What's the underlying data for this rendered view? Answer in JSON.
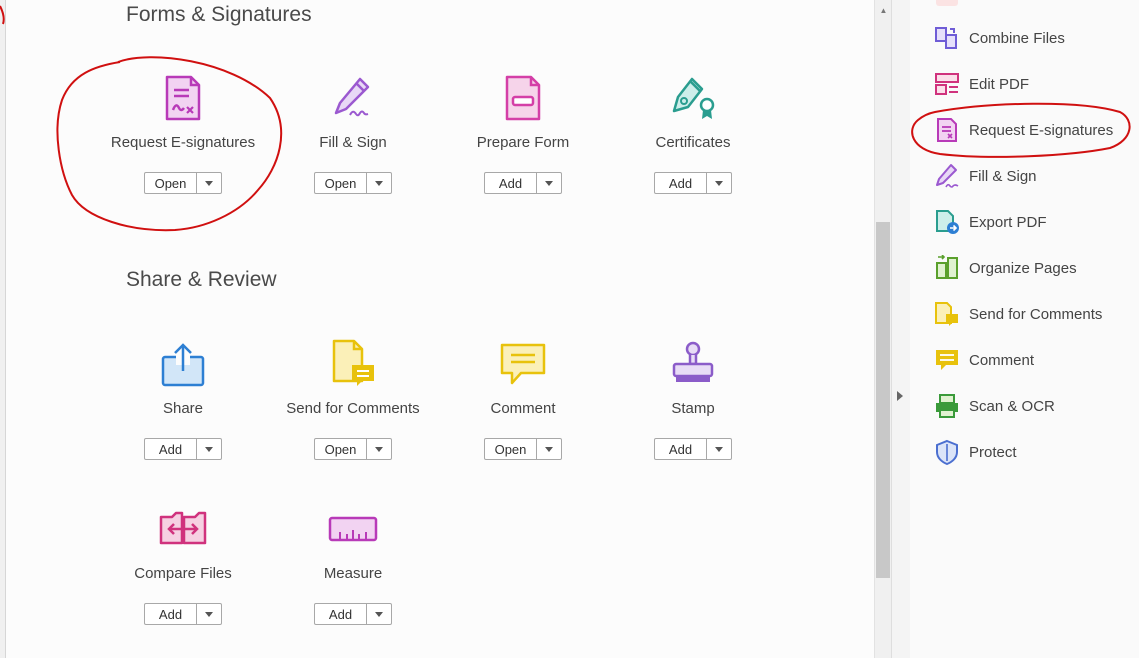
{
  "sections": [
    {
      "title": "Forms & Signatures"
    },
    {
      "title": "Share & Review"
    }
  ],
  "tools": [
    {
      "label": "Request E-signatures",
      "button": "Open",
      "icon": "request-esignatures-icon",
      "color": "#b83ab8"
    },
    {
      "label": "Fill & Sign",
      "button": "Open",
      "icon": "fill-sign-icon",
      "color": "#9b59d0"
    },
    {
      "label": "Prepare Form",
      "button": "Add",
      "icon": "prepare-form-icon",
      "color": "#d43fa7"
    },
    {
      "label": "Certificates",
      "button": "Add",
      "icon": "certificates-icon",
      "color": "#2a9d8f"
    },
    {
      "label": "Share",
      "button": "Add",
      "icon": "share-icon",
      "color": "#2d7fd3"
    },
    {
      "label": "Send for Comments",
      "button": "Open",
      "icon": "send-for-comments-icon",
      "color": "#e8c20c"
    },
    {
      "label": "Comment",
      "button": "Open",
      "icon": "comment-icon",
      "color": "#e8c20c"
    },
    {
      "label": "Stamp",
      "button": "Add",
      "icon": "stamp-icon",
      "color": "#8b5cc9"
    },
    {
      "label": "Compare Files",
      "button": "Add",
      "icon": "compare-files-icon",
      "color": "#d0327d"
    },
    {
      "label": "Measure",
      "button": "Add",
      "icon": "measure-icon",
      "color": "#b83ab8"
    }
  ],
  "right_panel": {
    "items": [
      {
        "label": "Combine Files",
        "icon": "combine-files-icon"
      },
      {
        "label": "Edit PDF",
        "icon": "edit-pdf-icon"
      },
      {
        "label": "Request E-signatures",
        "icon": "request-esignatures-icon"
      },
      {
        "label": "Fill & Sign",
        "icon": "fill-sign-icon"
      },
      {
        "label": "Export PDF",
        "icon": "export-pdf-icon"
      },
      {
        "label": "Organize Pages",
        "icon": "organize-pages-icon"
      },
      {
        "label": "Send for Comments",
        "icon": "send-for-comments-icon"
      },
      {
        "label": "Comment",
        "icon": "comment-icon"
      },
      {
        "label": "Scan & OCR",
        "icon": "scan-ocr-icon"
      },
      {
        "label": "Protect",
        "icon": "protect-icon"
      }
    ]
  },
  "annotation_color": "#d01010"
}
